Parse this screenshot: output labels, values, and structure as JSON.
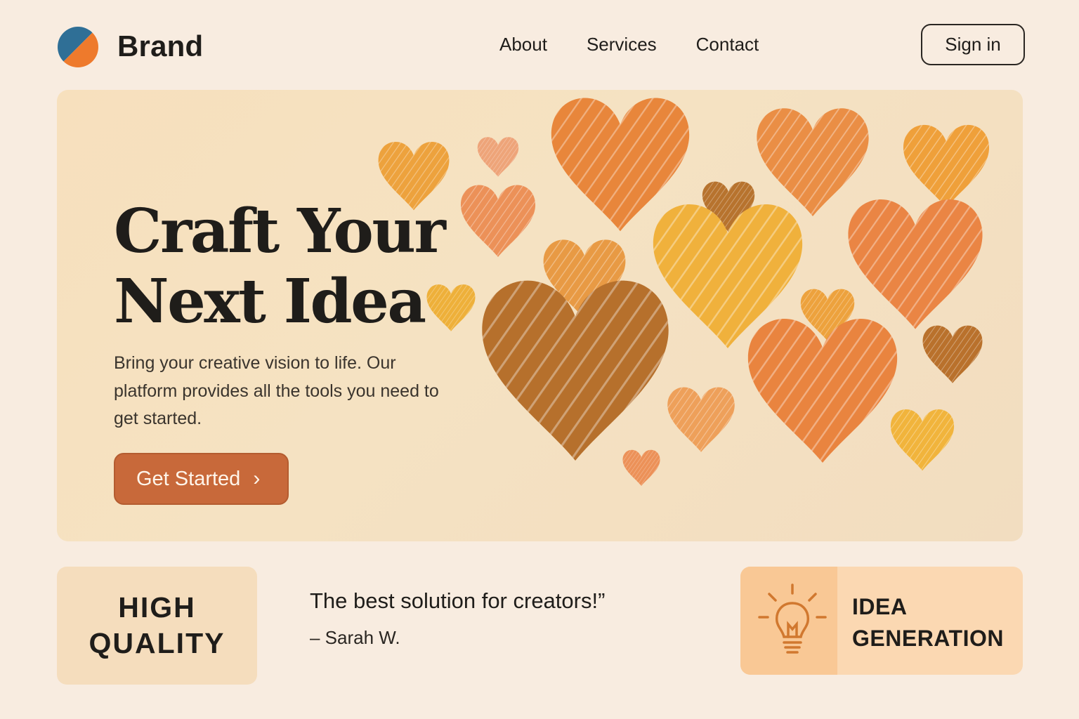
{
  "header": {
    "brand": "Brand",
    "nav": [
      {
        "label": "About"
      },
      {
        "label": "Services"
      },
      {
        "label": "Contact"
      }
    ],
    "signin_label": "Sign in"
  },
  "hero": {
    "title_line1": "Craft Your",
    "title_line2": "Next Idea",
    "subtitle": "Bring your creative vision to life. Our platform provides all the tools you need to get started.",
    "cta_label": "Get Started",
    "cta_icon": "chevron-right-icon"
  },
  "features": {
    "quality_line1": "HIGH",
    "quality_line2": "QUALITY",
    "quote": "The best solution for creators!”",
    "author": "– Sarah W.",
    "idea_line1": "IDEA",
    "idea_line2": "GENERATION",
    "idea_icon": "lightbulb-icon"
  },
  "colors": {
    "background": "#f8ece0",
    "hero_background": "#f5e2c2",
    "accent": "#c8693a",
    "logo_blue": "#2f6f96",
    "logo_orange": "#ee7a2c",
    "idea_card": "#fbd8b2"
  }
}
